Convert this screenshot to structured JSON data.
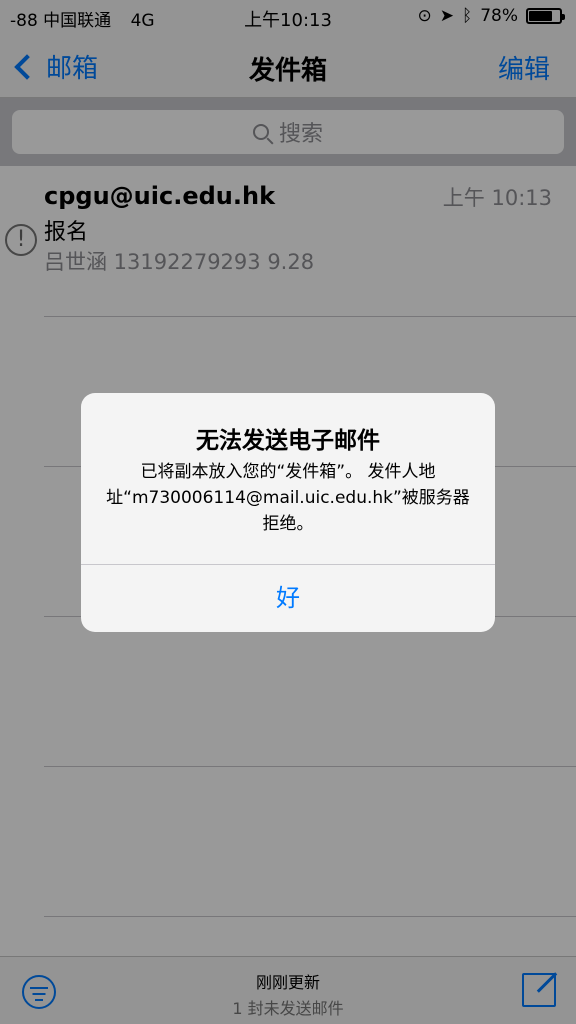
{
  "status_bar": {
    "carrier": "-88 中国联通",
    "network": "4G",
    "time": "上午10:13",
    "battery_percent": "78%",
    "battery_level": 0.78
  },
  "nav": {
    "back_label": "邮箱",
    "title": "发件箱",
    "edit_label": "编辑"
  },
  "search": {
    "placeholder": "搜索"
  },
  "messages": [
    {
      "sender": "cpgu@uic.edu.hk",
      "time": "上午 10:13",
      "subject": "报名",
      "preview": "吕世涵 13192279293 9.28",
      "status_icon": "exclamation-circle-icon"
    }
  ],
  "toolbar": {
    "status_title": "刚刚更新",
    "status_subtitle": "1 封未发送邮件"
  },
  "alert": {
    "title": "无法发送电子邮件",
    "message": "已将副本放入您的“发件箱”。 发件人地址“m730006114@mail.uic.edu.hk”被服务器拒绝。",
    "button": "好"
  },
  "colors": {
    "accent": "#007aff",
    "secondary_text": "#8e8e93"
  }
}
